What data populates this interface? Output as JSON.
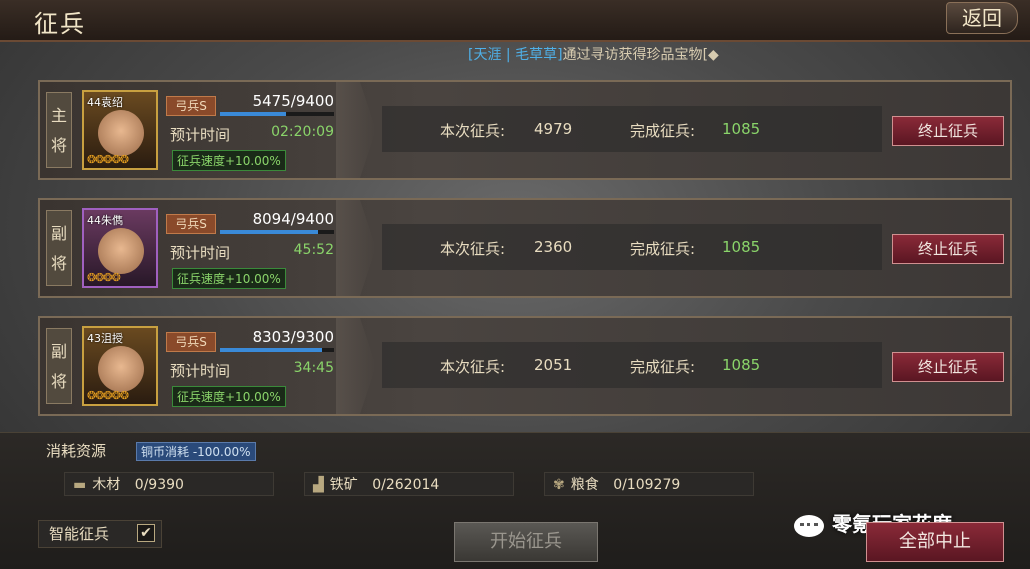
{
  "header": {
    "title": "征兵",
    "back_label": "返回"
  },
  "ticker": {
    "tag1": "[天涯",
    "sep": " | ",
    "tag2": "毛草草]",
    "message": "通过寻访获得珍品宝物",
    "tail": "[◆"
  },
  "rows": [
    {
      "role": "主将",
      "level_name": "44袁绍",
      "stars": "❂❂❂❂❂",
      "troop_type": "弓兵S",
      "count": "5475/9400",
      "progress": 0.5824,
      "eta_label": "预计时间",
      "eta": "02:20:09",
      "speed": "征兵速度+10.00%",
      "current_label": "本次征兵:",
      "current": "4979",
      "done_label": "完成征兵:",
      "done": "1085",
      "stop_label": "终止征兵"
    },
    {
      "role": "副将",
      "level_name": "44朱儁",
      "stars": "❂❂❂❂",
      "troop_type": "弓兵S",
      "count": "8094/9400",
      "progress": 0.8611,
      "eta_label": "预计时间",
      "eta": "45:52",
      "speed": "征兵速度+10.00%",
      "current_label": "本次征兵:",
      "current": "2360",
      "done_label": "完成征兵:",
      "done": "1085",
      "stop_label": "终止征兵"
    },
    {
      "role": "副将",
      "level_name": "43沮授",
      "stars": "❂❂❂❂❂",
      "troop_type": "弓兵S",
      "count": "8303/9300",
      "progress": 0.8928,
      "eta_label": "预计时间",
      "eta": "34:45",
      "speed": "征兵速度+10.00%",
      "current_label": "本次征兵:",
      "current": "2051",
      "done_label": "完成征兵:",
      "done": "1085",
      "stop_label": "终止征兵"
    }
  ],
  "resources": {
    "title": "消耗资源",
    "discount": "铜币消耗 -100.00%",
    "wood": {
      "label": "木材",
      "value": "0/9390",
      "icon": "wood-icon"
    },
    "iron": {
      "label": "铁矿",
      "value": "0/262014",
      "icon": "anvil-icon"
    },
    "grain": {
      "label": "粮食",
      "value": "0/109279",
      "icon": "grain-icon"
    }
  },
  "controls": {
    "auto_label": "智能征兵",
    "auto_checked": "✔",
    "start_label": "开始征兵",
    "stop_all_label": "全部中止"
  },
  "watermark": "零氪玩家花席",
  "colors": {
    "accent_green": "#8ad46a",
    "button_red": "#8a2a38",
    "progress_blue": "#3a8ad8"
  }
}
